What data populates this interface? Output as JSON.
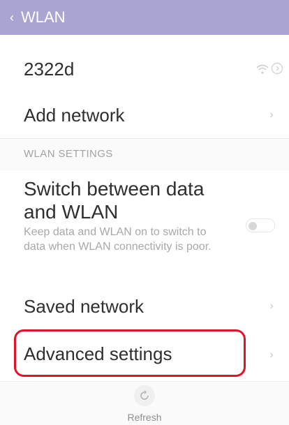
{
  "header": {
    "title": "WLAN",
    "back_icon": "‹"
  },
  "network": {
    "name": "2322d"
  },
  "rows": {
    "add_network": "Add network",
    "saved_network": "Saved network",
    "advanced_settings": "Advanced settings"
  },
  "wlan_settings": {
    "section_title": "WLAN SETTINGS",
    "switch_title": "Switch between data and WLAN",
    "switch_description": "Keep data and WLAN on to switch to data when WLAN connectivity is poor.",
    "toggle_on": false
  },
  "bottom": {
    "refresh_label": "Refresh"
  },
  "colors": {
    "header": "#aaa4d3",
    "highlight": "#e0132c"
  },
  "icons": {
    "back": "chevron-left-icon",
    "wifi": "wifi-icon",
    "info": "info-icon",
    "chevron": "chevron-right-icon",
    "refresh": "refresh-icon"
  }
}
